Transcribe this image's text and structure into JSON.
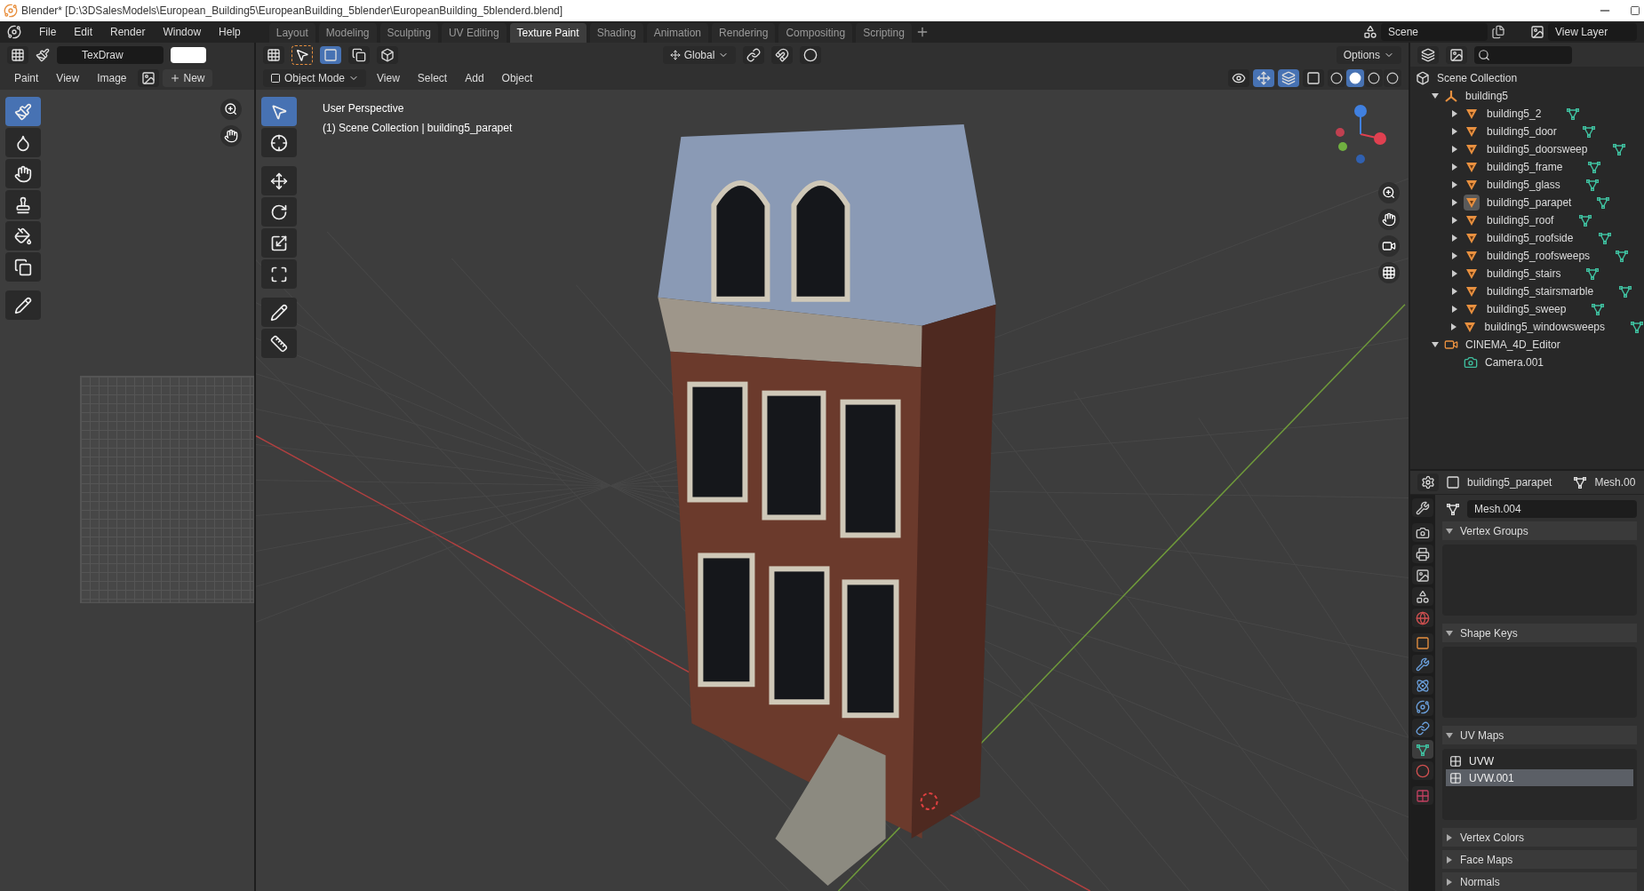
{
  "window": {
    "title": "Blender* [D:\\3DSalesModels\\European_Building5\\EuropeanBuilding_5blender\\EuropeanBuilding_5blenderd.blend]"
  },
  "menu": [
    "File",
    "Edit",
    "Render",
    "Window",
    "Help"
  ],
  "workspaces": [
    {
      "label": "Layout",
      "selected": false
    },
    {
      "label": "Modeling",
      "selected": false
    },
    {
      "label": "Sculpting",
      "selected": false
    },
    {
      "label": "UV Editing",
      "selected": false
    },
    {
      "label": "Texture Paint",
      "selected": true
    },
    {
      "label": "Shading",
      "selected": false
    },
    {
      "label": "Animation",
      "selected": false
    },
    {
      "label": "Rendering",
      "selected": false
    },
    {
      "label": "Compositing",
      "selected": false
    },
    {
      "label": "Scripting",
      "selected": false
    }
  ],
  "scene": {
    "name": "Scene",
    "view_layer": "View Layer"
  },
  "image_editor": {
    "brush": "TexDraw",
    "mode": "Paint",
    "menu": [
      "View",
      "Image"
    ],
    "new_button": "New",
    "tools": [
      {
        "selected": true
      },
      {
        "selected": false
      },
      {
        "selected": false
      },
      {
        "selected": false
      },
      {
        "selected": false
      },
      {
        "selected": false
      },
      {
        "selected": false
      }
    ]
  },
  "viewport": {
    "mode": "Object Mode",
    "menu": [
      "View",
      "Select",
      "Add",
      "Object"
    ],
    "orientation": "Global",
    "options": "Options",
    "overlay": [
      "User Perspective",
      "(1) Scene Collection | building5_parapet"
    ],
    "tools": [
      {
        "selected": true
      },
      {
        "selected": false
      },
      {
        "selected": false
      },
      {
        "selected": false
      },
      {
        "selected": false
      },
      {
        "selected": false
      },
      {
        "selected": false
      },
      {
        "selected": false
      }
    ],
    "shading": [
      {
        "selected": false
      },
      {
        "selected": true
      },
      {
        "selected": false
      },
      {
        "selected": false
      }
    ]
  },
  "outliner": {
    "root": "Scene Collection",
    "tree": [
      {
        "name": "building5",
        "kind": "empty",
        "expanded": true,
        "children": [
          {
            "name": "building5_2",
            "kind": "mesh",
            "expanded": false,
            "selected": false
          },
          {
            "name": "building5_door",
            "kind": "mesh",
            "expanded": false,
            "selected": false
          },
          {
            "name": "building5_doorsweep",
            "kind": "mesh",
            "expanded": false,
            "selected": false
          },
          {
            "name": "building5_frame",
            "kind": "mesh",
            "expanded": false,
            "selected": false
          },
          {
            "name": "building5_glass",
            "kind": "mesh",
            "expanded": false,
            "selected": false
          },
          {
            "name": "building5_parapet",
            "kind": "mesh",
            "expanded": false,
            "selected": true
          },
          {
            "name": "building5_roof",
            "kind": "mesh",
            "expanded": false,
            "selected": false
          },
          {
            "name": "building5_roofside",
            "kind": "mesh",
            "expanded": false,
            "selected": false
          },
          {
            "name": "building5_roofsweeps",
            "kind": "mesh",
            "expanded": false,
            "selected": false
          },
          {
            "name": "building5_stairs",
            "kind": "mesh",
            "expanded": false,
            "selected": false
          },
          {
            "name": "building5_stairsmarble",
            "kind": "mesh",
            "expanded": false,
            "selected": false
          },
          {
            "name": "building5_sweep",
            "kind": "mesh",
            "expanded": false,
            "selected": false
          },
          {
            "name": "building5_windowsweeps",
            "kind": "mesh",
            "expanded": false,
            "selected": false
          }
        ]
      },
      {
        "name": "CINEMA_4D_Editor",
        "kind": "camera_object",
        "expanded": true,
        "children": [
          {
            "name": "Camera.001",
            "kind": "camera_data"
          }
        ]
      }
    ]
  },
  "properties": {
    "object": "building5_parapet",
    "data": "Mesh.00",
    "mesh": "Mesh.004",
    "tabs": [
      {
        "selected": false
      },
      {
        "selected": false
      },
      {
        "selected": false
      },
      {
        "selected": false
      },
      {
        "selected": false
      },
      {
        "selected": false
      },
      {
        "selected": false
      },
      {
        "selected": false
      },
      {
        "selected": false
      },
      {
        "selected": false
      },
      {
        "selected": false
      },
      {
        "selected": true
      },
      {
        "selected": false
      },
      {
        "selected": false
      }
    ],
    "panels": [
      {
        "title": "Vertex Groups",
        "expanded": true
      },
      {
        "title": "Shape Keys",
        "expanded": true
      },
      {
        "title": "UV Maps",
        "expanded": true,
        "items": [
          {
            "name": "UVW",
            "selected": false
          },
          {
            "name": "UVW.001",
            "selected": true
          }
        ]
      },
      {
        "title": "Vertex Colors",
        "expanded": false
      },
      {
        "title": "Face Maps",
        "expanded": false
      },
      {
        "title": "Normals",
        "expanded": false
      }
    ]
  }
}
